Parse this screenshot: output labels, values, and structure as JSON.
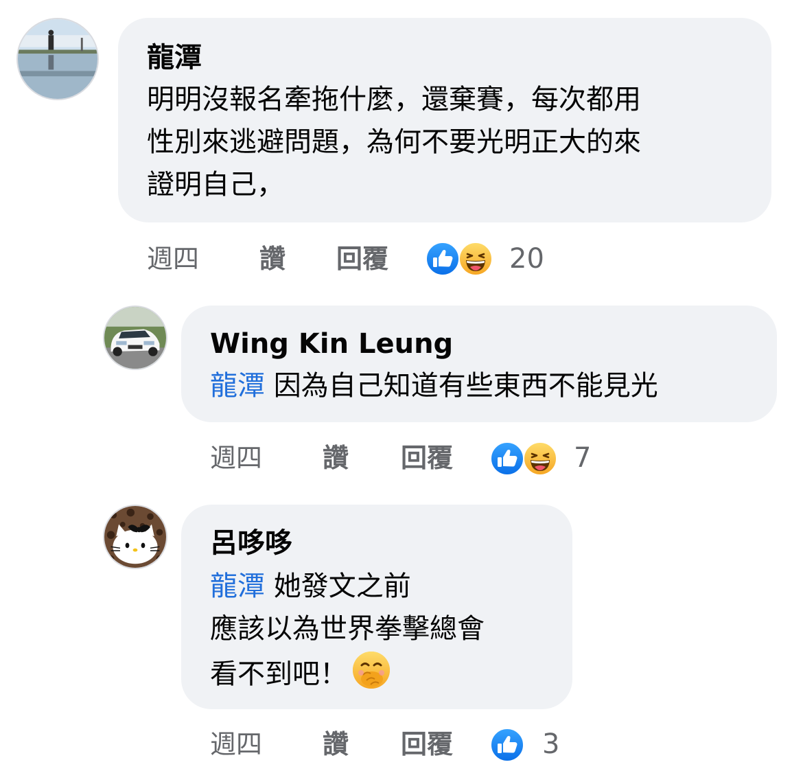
{
  "comments": [
    {
      "author": "龍潭",
      "lines": [
        "明明沒報名牽拖什麼，還棄賽，每次都用",
        "性別來逃避問題，為何不要光明正大的來",
        "證明自己，"
      ],
      "time": "週四",
      "like": "讚",
      "reply": "回覆",
      "reaction_icons": [
        "like-icon",
        "haha-icon"
      ],
      "reaction_count": "20"
    },
    {
      "author": "Wing Kin Leung",
      "mention": "龍潭",
      "lines": [
        "因為自己知道有些東西不能見光"
      ],
      "time": "週四",
      "like": "讚",
      "reply": "回覆",
      "reaction_icons": [
        "like-icon",
        "haha-icon"
      ],
      "reaction_count": "7"
    },
    {
      "author": "呂哆哆",
      "mention": "龍潭",
      "lines": [
        "她發文之前",
        "應該以為世界拳擊總會",
        "看不到吧！"
      ],
      "inline_emoji": "face-with-hand-over-mouth-icon",
      "time": "週四",
      "like": "讚",
      "reply": "回覆",
      "reaction_icons": [
        "like-icon"
      ],
      "reaction_count": "3"
    }
  ],
  "colors": {
    "bubble": "#f0f2f5",
    "mention": "#216fdb",
    "meta": "#65676b",
    "like": "#1877f2",
    "haha": "#f7b125"
  }
}
